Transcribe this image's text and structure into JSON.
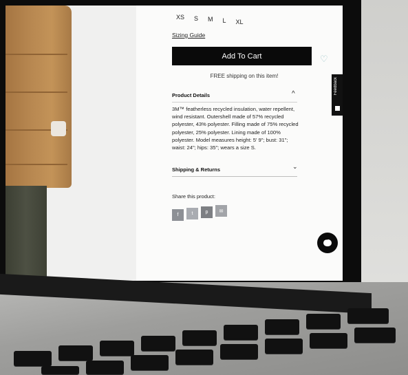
{
  "product": {
    "sizes": [
      "XS",
      "S",
      "M",
      "L",
      "XL"
    ],
    "sizing_guide_label": "Sizing Guide",
    "add_to_cart_label": "Add To Cart",
    "shipping_note": "FREE shipping on this item!",
    "details": {
      "title": "Product Details",
      "text": "3M™ featherless recycled insulation, water repellent, wind resistant. Outershell made of 57% recycled polyester, 43% polyester. Filling made of 75% recycled polyester, 25% polyester. Lining made of 100% polyester. Model measures height: 5' 9\"; bust: 31\"; waist: 24\"; hips: 35\"; wears a size S."
    },
    "shipping_returns": {
      "title": "Shipping & Returns"
    },
    "share": {
      "label": "Share this product:",
      "buttons": [
        {
          "name": "facebook",
          "glyph": "f"
        },
        {
          "name": "twitter",
          "glyph": "t"
        },
        {
          "name": "pinterest",
          "glyph": "p"
        },
        {
          "name": "email",
          "glyph": "✉"
        }
      ]
    }
  },
  "feedback_tab": {
    "label": "Feedback"
  },
  "colors": {
    "button_bg": "#0a0a0a",
    "heart": "#9cc6ca",
    "coat": "#b88851"
  },
  "icons": {
    "heart": "heart-outline-icon",
    "caret_up": "chevron-up-icon",
    "caret_down": "chevron-down-icon",
    "chat": "chat-bubble-icon"
  }
}
